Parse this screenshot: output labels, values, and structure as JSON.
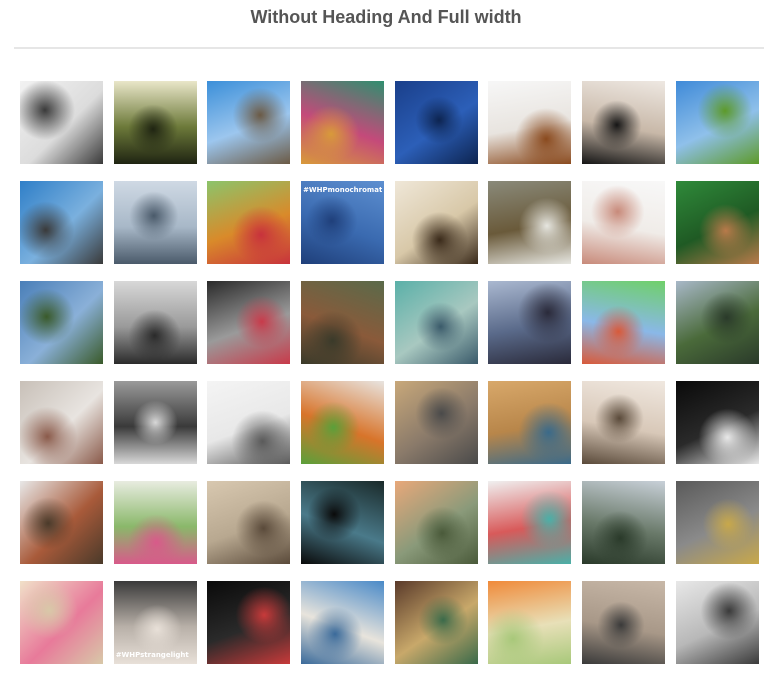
{
  "page": {
    "title": "Without Heading And Full width"
  },
  "gallery": {
    "tiles": [
      {
        "subject": "masked-figure-photo",
        "colors": [
          "#f2f2f2",
          "#dcdcdc",
          "#3a3a3a"
        ],
        "caption": ""
      },
      {
        "subject": "forest-sunlight-photo",
        "colors": [
          "#e9e6c9",
          "#6d7a3a",
          "#1f2412"
        ],
        "caption": ""
      },
      {
        "subject": "dog-jumping-rocks-photo",
        "colors": [
          "#3b8fd9",
          "#9cc6ee",
          "#6b5a45"
        ],
        "caption": ""
      },
      {
        "subject": "color-collage-photo",
        "colors": [
          "#2f8f6f",
          "#c44a7a",
          "#d89a3a"
        ],
        "caption": ""
      },
      {
        "subject": "cloud-rain-plate-photo",
        "colors": [
          "#1a3f8a",
          "#2c5fb8",
          "#0d2450"
        ],
        "caption": ""
      },
      {
        "subject": "watercolor-painting-photo",
        "colors": [
          "#f7f7f7",
          "#e8e4df",
          "#8a4a1e"
        ],
        "caption": ""
      },
      {
        "subject": "tree-silhouette-photo",
        "colors": [
          "#eee8e2",
          "#c8b8a8",
          "#151515"
        ],
        "caption": ""
      },
      {
        "subject": "green-hills-sky-photo",
        "colors": [
          "#3f8ad8",
          "#8fc0ea",
          "#5d9a2a"
        ],
        "caption": ""
      },
      {
        "subject": "skateboard-jump-photo",
        "colors": [
          "#2f7fc8",
          "#7ab0de",
          "#3a3a3a"
        ],
        "caption": ""
      },
      {
        "subject": "lone-tree-field-photo",
        "colors": [
          "#cfd9e4",
          "#a8b8c8",
          "#4a5a6a"
        ],
        "caption": ""
      },
      {
        "subject": "donuts-dog-photo",
        "colors": [
          "#8bc46b",
          "#d98a2a",
          "#c8323c"
        ],
        "caption": ""
      },
      {
        "subject": "monochromatic-blue-photo",
        "colors": [
          "#5d8fd0",
          "#3a6ab0",
          "#1f3f7a"
        ],
        "caption": "#WHPmonochromatic"
      },
      {
        "subject": "illustrated-figures-photo",
        "colors": [
          "#efe7d8",
          "#d8c8a8",
          "#3a2a1a"
        ],
        "caption": ""
      },
      {
        "subject": "barn-goat-photo",
        "colors": [
          "#8a8a7a",
          "#6a5a3a",
          "#e6e6e0"
        ],
        "caption": ""
      },
      {
        "subject": "painted-hands-photo",
        "colors": [
          "#f8f8f8",
          "#f0ece8",
          "#c88a7a"
        ],
        "caption": ""
      },
      {
        "subject": "green-globe-hands-photo",
        "colors": [
          "#2f8a3a",
          "#1f5a24",
          "#b87a4a"
        ],
        "caption": ""
      },
      {
        "subject": "mirror-sphere-photo",
        "colors": [
          "#4a7fb8",
          "#8ab0d8",
          "#3a5a2a"
        ],
        "caption": ""
      },
      {
        "subject": "woman-portrait-photo",
        "colors": [
          "#d8d8d8",
          "#9a9a9a",
          "#2a2a2a"
        ],
        "caption": ""
      },
      {
        "subject": "city-smoke-photo",
        "colors": [
          "#2a2a2a",
          "#9a9a9a",
          "#c83a4a"
        ],
        "caption": ""
      },
      {
        "subject": "teddy-bears-photo",
        "colors": [
          "#5a6a4a",
          "#8a5a3a",
          "#3a3a2a"
        ],
        "caption": ""
      },
      {
        "subject": "photo-grid-photo",
        "colors": [
          "#5ab0a8",
          "#a8c8c0",
          "#3a5a6a"
        ],
        "caption": ""
      },
      {
        "subject": "person-on-rocks-photo",
        "colors": [
          "#aab8d0",
          "#5a6a8a",
          "#2a2a3a"
        ],
        "caption": ""
      },
      {
        "subject": "robot-illustration-photo",
        "colors": [
          "#6fd06a",
          "#8ab8e8",
          "#d85a3a"
        ],
        "caption": ""
      },
      {
        "subject": "mountain-valley-photo",
        "colors": [
          "#a8b8c8",
          "#4a6a3a",
          "#2a3a2a"
        ],
        "caption": ""
      },
      {
        "subject": "snowy-buildings-photo",
        "colors": [
          "#c8c0b8",
          "#e8e4e0",
          "#8a5a4a"
        ],
        "caption": ""
      },
      {
        "subject": "striped-shadow-photo",
        "colors": [
          "#9a9a9a",
          "#3a3a3a",
          "#d8d8d8"
        ],
        "caption": ""
      },
      {
        "subject": "flying-kites-photo",
        "colors": [
          "#f4f4f4",
          "#e8e8e8",
          "#5a5a5a"
        ],
        "caption": ""
      },
      {
        "subject": "hotdog-hat-photo",
        "colors": [
          "#e8e4e0",
          "#d8742a",
          "#5aa03a"
        ],
        "caption": ""
      },
      {
        "subject": "misty-tower-photo",
        "colors": [
          "#c8a87a",
          "#8a7a6a",
          "#4a4a4a"
        ],
        "caption": ""
      },
      {
        "subject": "painting-hand-photo",
        "colors": [
          "#d8a86a",
          "#b8864a",
          "#3a6a8a"
        ],
        "caption": ""
      },
      {
        "subject": "ink-drawing-photo",
        "colors": [
          "#f0e8e0",
          "#d8c8b8",
          "#5a4a3a"
        ],
        "caption": ""
      },
      {
        "subject": "white-bird-photo",
        "colors": [
          "#0a0a0a",
          "#2a2a2a",
          "#e8e8e8"
        ],
        "caption": ""
      },
      {
        "subject": "winter-forest-photo",
        "colors": [
          "#e8e8e8",
          "#a85a3a",
          "#4a3a2a"
        ],
        "caption": ""
      },
      {
        "subject": "floral-dress-photo",
        "colors": [
          "#e8ece0",
          "#8ab86a",
          "#d85a8a"
        ],
        "caption": ""
      },
      {
        "subject": "sleeping-cats-photo",
        "colors": [
          "#d8c8b0",
          "#b8a890",
          "#5a4a3a"
        ],
        "caption": ""
      },
      {
        "subject": "night-grid-photo",
        "colors": [
          "#1a2a2a",
          "#4a7a8a",
          "#0a0a0a"
        ],
        "caption": ""
      },
      {
        "subject": "city-aerial-photo",
        "colors": [
          "#e8a87a",
          "#8a9a7a",
          "#4a5a3a"
        ],
        "caption": ""
      },
      {
        "subject": "paint-swatches-photo",
        "colors": [
          "#f0f0f0",
          "#d85a5a",
          "#4ab0a8"
        ],
        "caption": ""
      },
      {
        "subject": "bmx-rider-photo",
        "colors": [
          "#c8d0d8",
          "#6a7a6a",
          "#2a3a2a"
        ],
        "caption": ""
      },
      {
        "subject": "turtle-hand-photo",
        "colors": [
          "#5a5a5a",
          "#8a8a8a",
          "#c8a84a"
        ],
        "caption": ""
      },
      {
        "subject": "pink-cookies-photo",
        "colors": [
          "#f0e0c8",
          "#e87a9a",
          "#d8c8a8"
        ],
        "caption": ""
      },
      {
        "subject": "stranger-light-photo",
        "colors": [
          "#3a3a3a",
          "#b8b0a8",
          "#e8e0d8"
        ],
        "caption": "#WHPstrangelight"
      },
      {
        "subject": "hooded-figure-photo",
        "colors": [
          "#0a0a0a",
          "#2a2a2a",
          "#c83a3a"
        ],
        "caption": ""
      },
      {
        "subject": "sketchbook-lake-photo",
        "colors": [
          "#4a8ac8",
          "#e8e4dc",
          "#3a6a9a"
        ],
        "caption": ""
      },
      {
        "subject": "painted-trees-photo",
        "colors": [
          "#5a3a2a",
          "#c8a86a",
          "#3a6a4a"
        ],
        "caption": ""
      },
      {
        "subject": "cabbage-orange-photo",
        "colors": [
          "#f08a3a",
          "#e8e0b8",
          "#a8c87a"
        ],
        "caption": ""
      },
      {
        "subject": "foggy-water-photo",
        "colors": [
          "#c8b8a8",
          "#a89888",
          "#3a3a3a"
        ],
        "caption": ""
      },
      {
        "subject": "gallery-visitors-photo",
        "colors": [
          "#e8e8e8",
          "#b8b8b8",
          "#3a3a3a"
        ],
        "caption": ""
      }
    ]
  }
}
